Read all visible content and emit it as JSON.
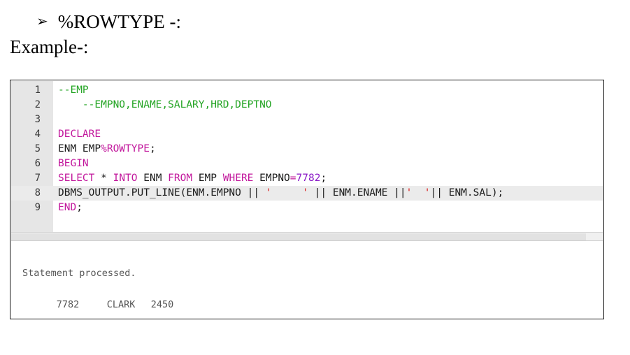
{
  "heading": {
    "bullet": "➢",
    "text": "%ROWTYPE -:"
  },
  "example_label": "Example-:",
  "editor": {
    "lines": [
      {
        "number": "1",
        "tokens": [
          {
            "text": "--EMP",
            "cls": "cm"
          }
        ]
      },
      {
        "number": "2",
        "tokens": [
          {
            "text": "    --EMPNO,ENAME,SALARY,HRD,DEPTNO",
            "cls": "cm"
          }
        ]
      },
      {
        "number": "3",
        "tokens": []
      },
      {
        "number": "4",
        "tokens": [
          {
            "text": "DECLARE",
            "cls": "kw"
          }
        ]
      },
      {
        "number": "5",
        "tokens": [
          {
            "text": "ENM EMP",
            "cls": ""
          },
          {
            "text": "%ROWTYPE",
            "cls": "kw"
          },
          {
            "text": ";",
            "cls": ""
          }
        ]
      },
      {
        "number": "6",
        "tokens": [
          {
            "text": "BEGIN",
            "cls": "kw"
          }
        ]
      },
      {
        "number": "7",
        "tokens": [
          {
            "text": "SELECT",
            "cls": "kw"
          },
          {
            "text": " * ",
            "cls": ""
          },
          {
            "text": "INTO",
            "cls": "kw"
          },
          {
            "text": " ENM ",
            "cls": ""
          },
          {
            "text": "FROM",
            "cls": "kw"
          },
          {
            "text": " EMP ",
            "cls": ""
          },
          {
            "text": "WHERE",
            "cls": "kw"
          },
          {
            "text": " EMPNO",
            "cls": ""
          },
          {
            "text": "=",
            "cls": "kw"
          },
          {
            "text": "7782",
            "cls": "num"
          },
          {
            "text": ";",
            "cls": ""
          }
        ]
      },
      {
        "number": "8",
        "current": true,
        "tokens": [
          {
            "text": "DBMS_OUTPUT.PUT_LINE(ENM.EMPNO || ",
            "cls": ""
          },
          {
            "text": "'     '",
            "cls": "str"
          },
          {
            "text": " || ENM.ENAME ||",
            "cls": ""
          },
          {
            "text": "'  '",
            "cls": "str"
          },
          {
            "text": "|| ENM.SAL);",
            "cls": ""
          }
        ]
      },
      {
        "number": "9",
        "tokens": [
          {
            "text": "END",
            "cls": "kw"
          },
          {
            "text": ";",
            "cls": ""
          }
        ]
      }
    ]
  },
  "output": {
    "status": "Statement processed.",
    "row": {
      "empno": "7782",
      "ename": "CLARK",
      "sal": "2450"
    }
  }
}
